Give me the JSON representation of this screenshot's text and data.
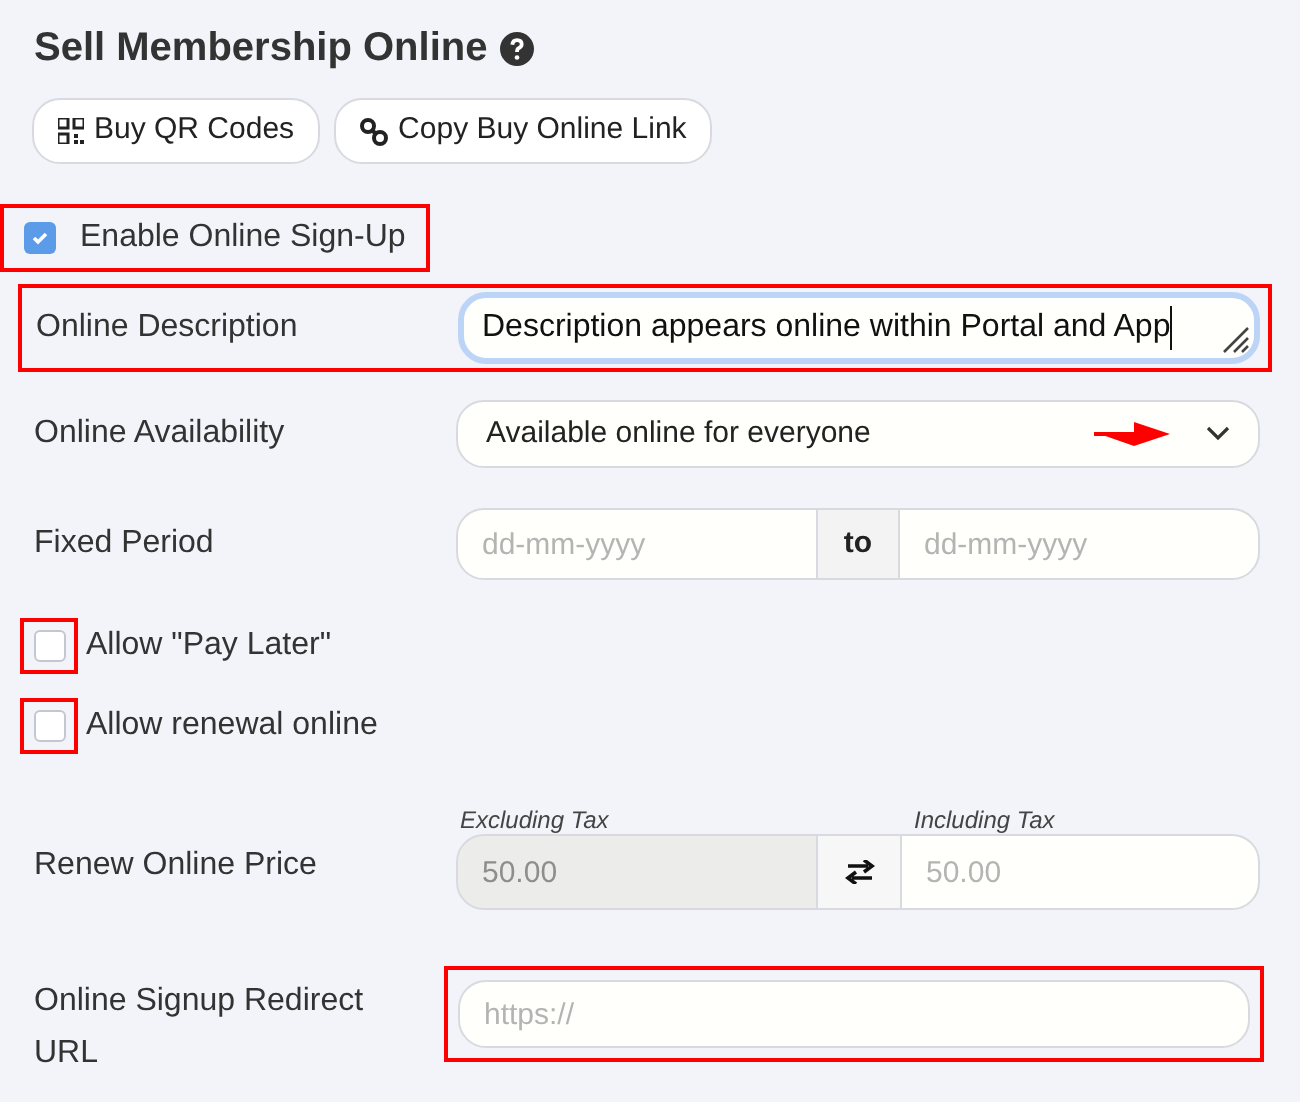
{
  "title": "Sell Membership Online",
  "buttons": [
    {
      "label": "Buy QR Codes",
      "kind": "qr"
    },
    {
      "label": "Copy Buy Online Link",
      "kind": "link"
    }
  ],
  "rows": [
    {
      "kind": "checkbox",
      "label": "Enable Online Sign-Up",
      "checked": true,
      "highlighted": true
    },
    {
      "kind": "textarea",
      "label": "Online Description",
      "value": "Description appears online within Portal and App",
      "highlighted": true
    },
    {
      "kind": "select",
      "label": "Online Availability",
      "value": "Available online for everyone",
      "arrow_marker": true
    },
    {
      "kind": "date_range",
      "label": "Fixed Period",
      "from_placeholder": "dd-mm-yyyy",
      "separator": "to",
      "to_placeholder": "dd-mm-yyyy"
    },
    {
      "kind": "checkbox",
      "label": "Allow \"Pay Later\"",
      "checked": false,
      "highlighted": true,
      "frame_box_only": true
    },
    {
      "kind": "checkbox",
      "label": "Allow renewal online",
      "checked": false,
      "highlighted": true,
      "frame_box_only": true
    },
    {
      "kind": "price",
      "label": "Renew Online Price",
      "excl_label": "Excluding Tax",
      "excl_placeholder": "50.00",
      "excl_disabled": true,
      "incl_label": "Including Tax",
      "incl_placeholder": "50.00"
    },
    {
      "kind": "url",
      "label": "Online Signup Redirect URL",
      "placeholder": "https://",
      "highlighted": true
    }
  ]
}
